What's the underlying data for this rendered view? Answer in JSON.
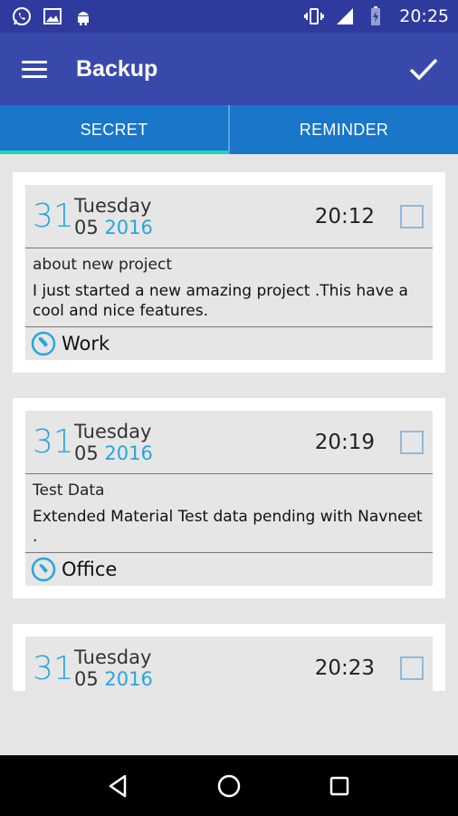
{
  "status_bar": {
    "time": "20:25",
    "left_icons": [
      "whatsapp-icon",
      "image-icon",
      "android-icon"
    ],
    "right_icons": [
      "vibrate-icon",
      "signal-icon",
      "battery-icon"
    ]
  },
  "app_bar": {
    "title": "Backup",
    "left_icon": "menu-icon",
    "right_icon": "check-icon"
  },
  "tabs": [
    {
      "label": "SECRET",
      "active": true
    },
    {
      "label": "REMINDER",
      "active": false
    }
  ],
  "notes": [
    {
      "day": "31",
      "weekday": "Tuesday",
      "month": "05",
      "year": "2016",
      "time": "20:12",
      "title": "about new project",
      "text": "I just started a new amazing project .This have a cool and nice features.",
      "category": "Work",
      "checked": false
    },
    {
      "day": "31",
      "weekday": "Tuesday",
      "month": "05",
      "year": "2016",
      "time": "20:19",
      "title": "Test Data",
      "text": "Extended Material Test data pending with Navneet .",
      "category": "Office",
      "checked": false
    },
    {
      "day": "31",
      "weekday": "Tuesday",
      "month": "05",
      "year": "2016",
      "time": "20:23",
      "checked": false
    }
  ],
  "colors": {
    "status_bar": "#2f3a9e",
    "app_bar": "#3949ab",
    "tabs": "#1976c8",
    "tab_indicator": "#21d3b3",
    "accent_blue": "#2aa5dc",
    "background": "#e5e5e5"
  },
  "nav_bar": {
    "icons": [
      "back-icon",
      "home-icon",
      "recents-icon"
    ]
  }
}
